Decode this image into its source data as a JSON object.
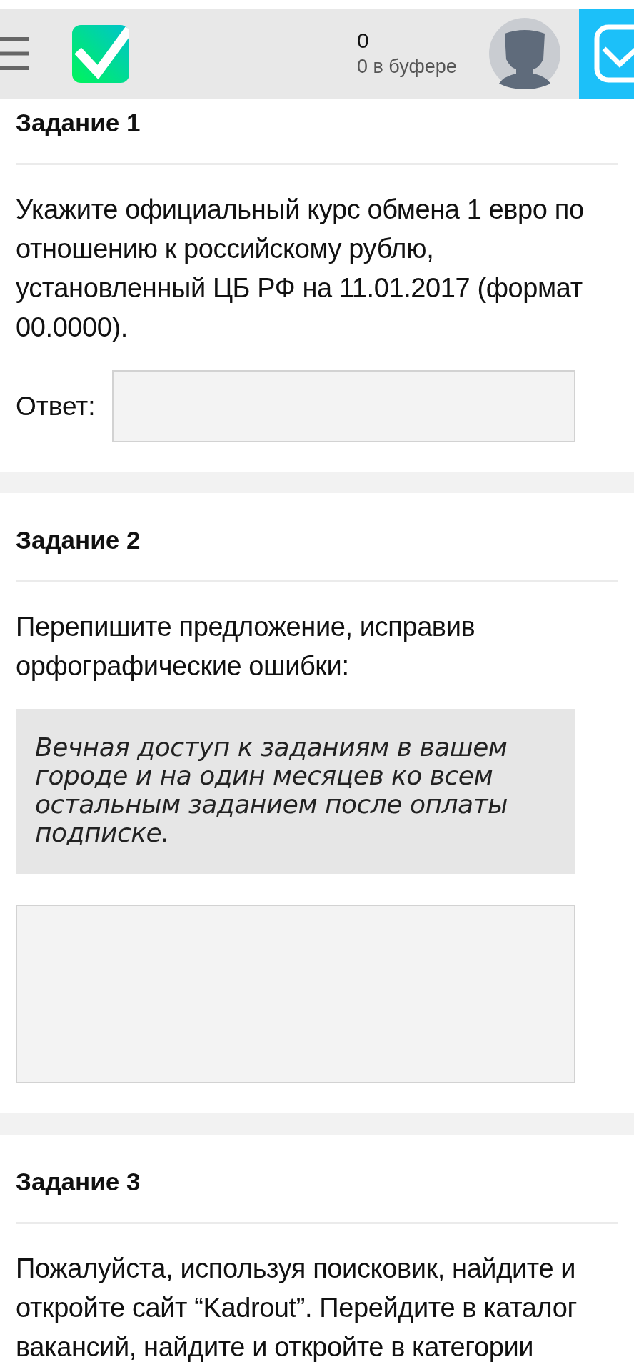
{
  "header": {
    "counter": "0",
    "buffer_label": "0 в буфере"
  },
  "tasks": [
    {
      "title": "Задание 1",
      "text": "Укажите официальный курс обмена 1 евро по отношению к российскому рублю, установленный ЦБ РФ на 11.01.2017 (формат 00.0000).",
      "answer": {
        "kind": "line",
        "label": "Ответ:"
      }
    },
    {
      "title": "Задание 2",
      "text": "Перепишите предложение, исправив орфографические ошибки:",
      "quote": "Вечная доступ к заданиям в вашем городе и на один месяцев ко всем остальным заданием после оплаты подписке.",
      "answer": {
        "kind": "area"
      }
    },
    {
      "title": "Задание 3",
      "text": "Пожалуйста, используя поисковик, найдите и откройте сайт “Kadrout”. Перейдите в каталог вакансий, найдите и откройте в категории"
    }
  ]
}
